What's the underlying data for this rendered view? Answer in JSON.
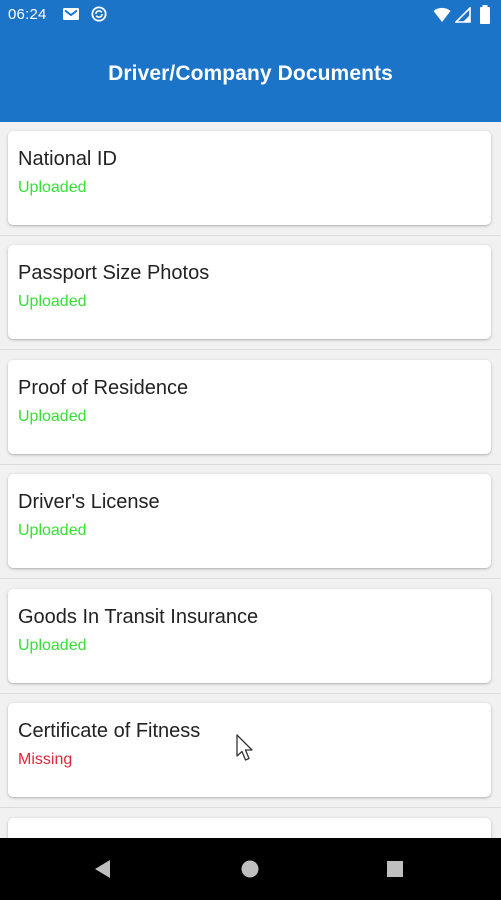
{
  "status_bar": {
    "time": "06:24",
    "icons": [
      "gmail-icon",
      "sync-icon",
      "wifi-icon",
      "signal-icon",
      "battery-icon"
    ]
  },
  "app_bar": {
    "title": "Driver/Company Documents"
  },
  "colors": {
    "primary": "#1c74c8",
    "uploaded": "#36e036",
    "missing": "#e02638"
  },
  "documents": [
    {
      "name": "National ID",
      "status": "Uploaded"
    },
    {
      "name": "Passport Size Photos",
      "status": "Uploaded"
    },
    {
      "name": "Proof of Residence",
      "status": "Uploaded"
    },
    {
      "name": "Driver's License",
      "status": "Uploaded"
    },
    {
      "name": "Goods In Transit Insurance",
      "status": "Uploaded"
    },
    {
      "name": "Certificate of Fitness",
      "status": "Missing"
    },
    {
      "name": "",
      "status": ""
    }
  ],
  "nav_bar": {
    "icons": [
      "back-icon",
      "home-icon",
      "recents-icon"
    ]
  }
}
